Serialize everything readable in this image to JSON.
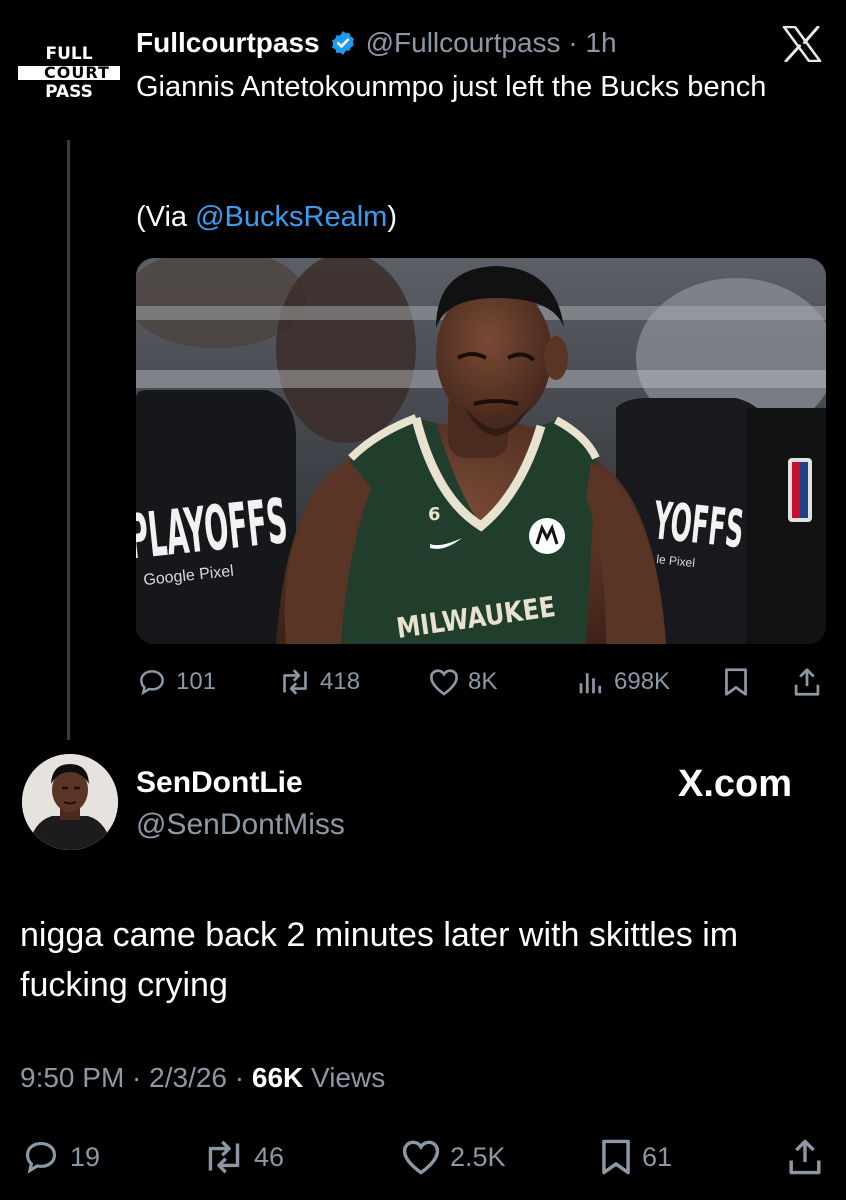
{
  "quoted_tweet": {
    "logo_text": [
      "FULL",
      "COURT",
      "PASS"
    ],
    "display_name": "Fullcourtpass",
    "verified": true,
    "handle_time": "@Fullcourtpass · 1h",
    "text": "Giannis Antetokounmpo just left the Bucks bench",
    "via_prefix": "(Via ",
    "via_link": "@BucksRealm",
    "via_suffix": ")",
    "image": {
      "jersey_text": "MILWAUKEE",
      "jersey_number": "6",
      "banner_left": "PLAYOFFS",
      "banner_left_sponsor": "Google Pixel",
      "banner_right": "YOFFS",
      "banner_right_sponsor": "le Pixel"
    },
    "stats": {
      "replies": "101",
      "reposts": "418",
      "likes": "8K",
      "views": "698K"
    }
  },
  "reply": {
    "display_name": "SenDontLie",
    "handle": "@SenDontMiss",
    "watermark": "X.com",
    "text": "nigga came back 2 minutes later with skittles im fucking crying",
    "timestamp": "9:50 PM · 2/3/26 · ",
    "views_count": "66K",
    "views_label": " Views",
    "stats": {
      "replies": "19",
      "reposts": "46",
      "likes": "2.5K",
      "bookmarks": "61"
    }
  },
  "colors": {
    "background": "#000000",
    "text": "#e7e9ea",
    "secondary": "#8b98a5",
    "link": "#3b9cf0",
    "verified": "#1d9bf0",
    "jersey": "#213d2c"
  },
  "icons": [
    "x-logo-icon",
    "verified-badge-icon",
    "reply-icon",
    "repost-icon",
    "like-icon",
    "views-icon",
    "bookmark-icon",
    "share-icon"
  ]
}
